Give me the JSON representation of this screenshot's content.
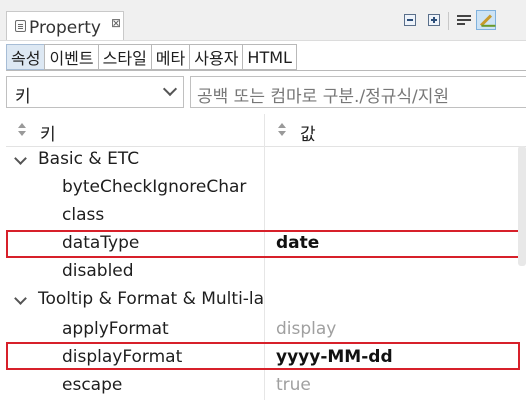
{
  "view": {
    "title": "Property",
    "close_glyph": "⊠",
    "toolbar": [
      {
        "icon": "minimize-icon"
      },
      {
        "icon": "maximize-icon"
      },
      {
        "icon": "word-wrap-icon"
      },
      {
        "icon": "edit-highlight-icon",
        "active": true
      }
    ]
  },
  "tabs": [
    "속성",
    "이벤트",
    "스타일",
    "메타",
    "사용자",
    "HTML"
  ],
  "selected_tab": "속성",
  "filter": {
    "combo_value": "키",
    "search_placeholder": "공백 또는 컴마로 구분./정규식/지원"
  },
  "table": {
    "col_key": "키",
    "col_value": "값"
  },
  "rows": [
    {
      "type": "group",
      "key": "Basic & ETC",
      "value": ""
    },
    {
      "type": "prop",
      "key": "byteCheckIgnoreChar",
      "value": ""
    },
    {
      "type": "prop",
      "key": "class",
      "value": ""
    },
    {
      "type": "prop",
      "key": "dataType",
      "value": "date",
      "style": "bold",
      "highlighted": true
    },
    {
      "type": "prop",
      "key": "disabled",
      "value": ""
    },
    {
      "type": "group",
      "key": "Tooltip & Format & Multi-la",
      "value": ""
    },
    {
      "type": "prop",
      "key": "applyFormat",
      "value": "display",
      "style": "gray"
    },
    {
      "type": "prop",
      "key": "displayFormat",
      "value": "yyyy-MM-dd",
      "style": "bold",
      "highlighted": true
    },
    {
      "type": "prop",
      "key": "escape",
      "value": "true",
      "style": "gray"
    }
  ],
  "colors": {
    "highlight_border": "#d7202a",
    "selected_tab_bg": "#dde8f3",
    "default_value_text": "#a0a0a0"
  }
}
